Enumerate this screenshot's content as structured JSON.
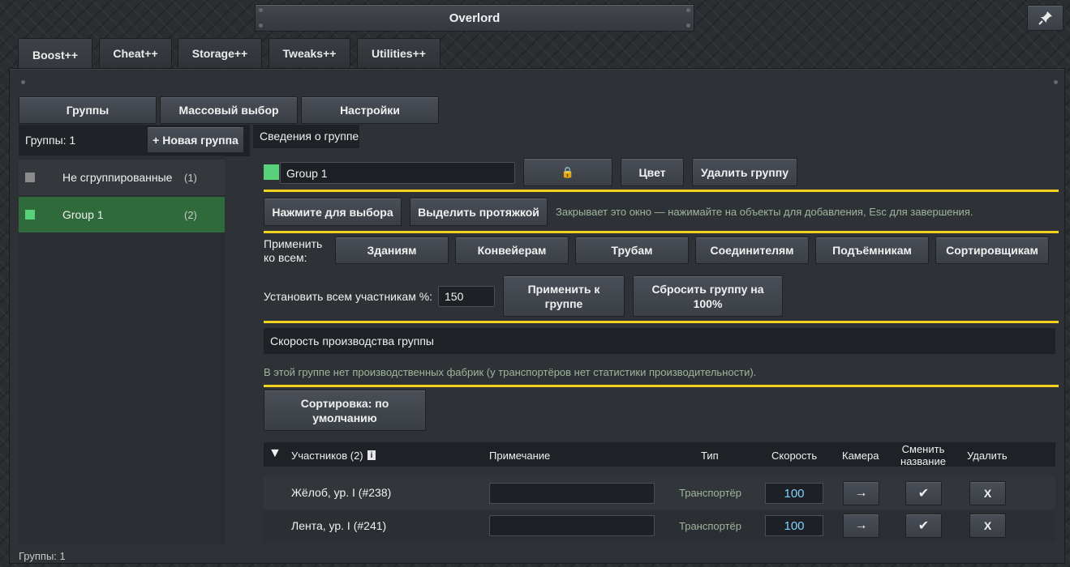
{
  "window": {
    "title": "Overlord",
    "pin_icon": "pin-icon"
  },
  "tabs": [
    {
      "label": "Boost++",
      "active": true
    },
    {
      "label": "Cheat++"
    },
    {
      "label": "Storage++"
    },
    {
      "label": "Tweaks++"
    },
    {
      "label": "Utilities++"
    }
  ],
  "subtabs": {
    "groups": "Группы",
    "mass_select": "Массовый выбор",
    "settings": "Настройки"
  },
  "sidebar": {
    "groups_count_label": "Группы: 1",
    "new_group_button": "+ Новая группа",
    "items": [
      {
        "name": "Не сгруппированные",
        "count": "(1)",
        "color": "#8a8a8a"
      },
      {
        "name": "Group 1",
        "count": "(2)",
        "color": "#58d17a",
        "selected": true
      }
    ],
    "footer_label": "Группы: 1"
  },
  "group_info": {
    "title": "Сведения о группе",
    "name_value": "Group 1",
    "color_swatch": "#58d17a",
    "lock_icon": "lock-icon",
    "lock_glyph": "🔒",
    "color_button": "Цвет",
    "delete_button": "Удалить группу"
  },
  "selection": {
    "click_select_button": "Нажмите для выбора",
    "drag_select_button": "Выделить протяжкой",
    "hint": "Закрывает это окно — нажимайте на объекты для добавления, Esc для завершения."
  },
  "apply_all": {
    "label_line1": "Применить",
    "label_line2": "ко всем:",
    "buttons": [
      "Зданиям",
      "Конвейерам",
      "Трубам",
      "Соединителям",
      "Подъёмникам",
      "Сортировщикам"
    ]
  },
  "percent": {
    "label": "Установить всем участникам %:",
    "value": "150",
    "apply_button": "Применить к группе",
    "reset_button": "Сбросить группу на 100%"
  },
  "production": {
    "header": "Скорость производства группы",
    "note": "В этой группе нет производственных фабрик (у транспортёров нет статистики производительности)."
  },
  "sort_button": "Сортировка: по умолчанию",
  "members_table": {
    "collapse_icon": "triangle-down-icon",
    "collapse_glyph": "▼",
    "members_label": "Участников (2)",
    "info_glyph": "i",
    "columns": {
      "note": "Примечание",
      "type": "Тип",
      "speed": "Скорость",
      "camera": "Камера",
      "rename": "Сменить название",
      "delete": "Удалить"
    },
    "rows": [
      {
        "name": "Жёлоб, ур. I (#238)",
        "note": "",
        "type": "Транспортёр",
        "speed": "100",
        "camera": "→",
        "rename": "✔",
        "delete": "X"
      },
      {
        "name": "Лента, ур. I (#241)",
        "note": "",
        "type": "Транспортёр",
        "speed": "100",
        "camera": "→",
        "rename": "✔",
        "delete": "X"
      }
    ]
  }
}
